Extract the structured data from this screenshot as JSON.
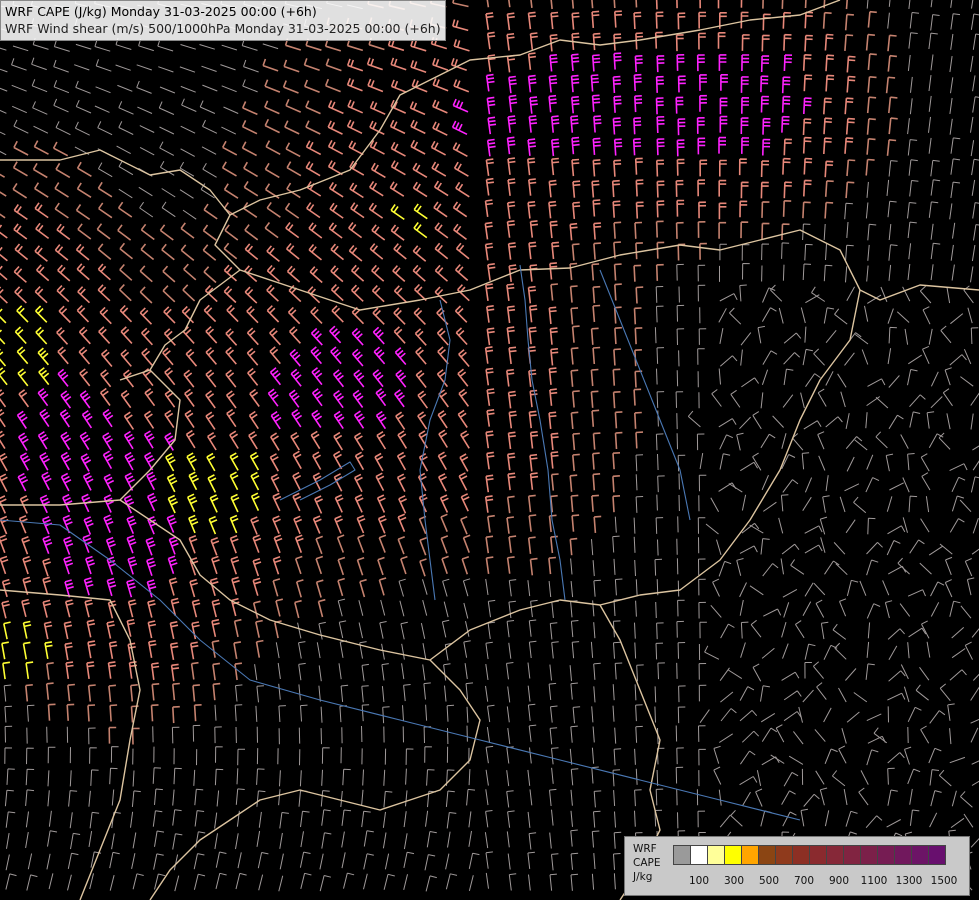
{
  "titles": {
    "line1": "WRF CAPE (J/kg) Monday 31-03-2025 00:00 (+6h)",
    "line2": "WRF Wind shear (m/s) 500/1000hPa Monday 31-03-2025 00:00 (+6h)"
  },
  "legend": {
    "label_lines": [
      "WRF",
      "CAPE",
      "J/kg"
    ],
    "colors": [
      "#9a9a9a",
      "#ffffff",
      "#ffff99",
      "#ffff00",
      "#ffa500",
      "#8b4513",
      "#8f3a1c",
      "#8c2f24",
      "#8a2a2e",
      "#862838",
      "#812441",
      "#7b2049",
      "#761c53",
      "#71185d",
      "#6c1466",
      "#680f6e"
    ],
    "tick_labels": [
      "100",
      "300",
      "500",
      "700",
      "900",
      "1100",
      "1300",
      "1500"
    ]
  },
  "map": {
    "background": "#000000",
    "barb_colors": {
      "weak": "#a09a9a",
      "moderate": "#c5826f",
      "strong": "#e8887a",
      "very_strong": "#ff22ff",
      "extreme": "#ffff33"
    },
    "border_color": "#dcc4a0",
    "river_color": "#4a78b4"
  }
}
